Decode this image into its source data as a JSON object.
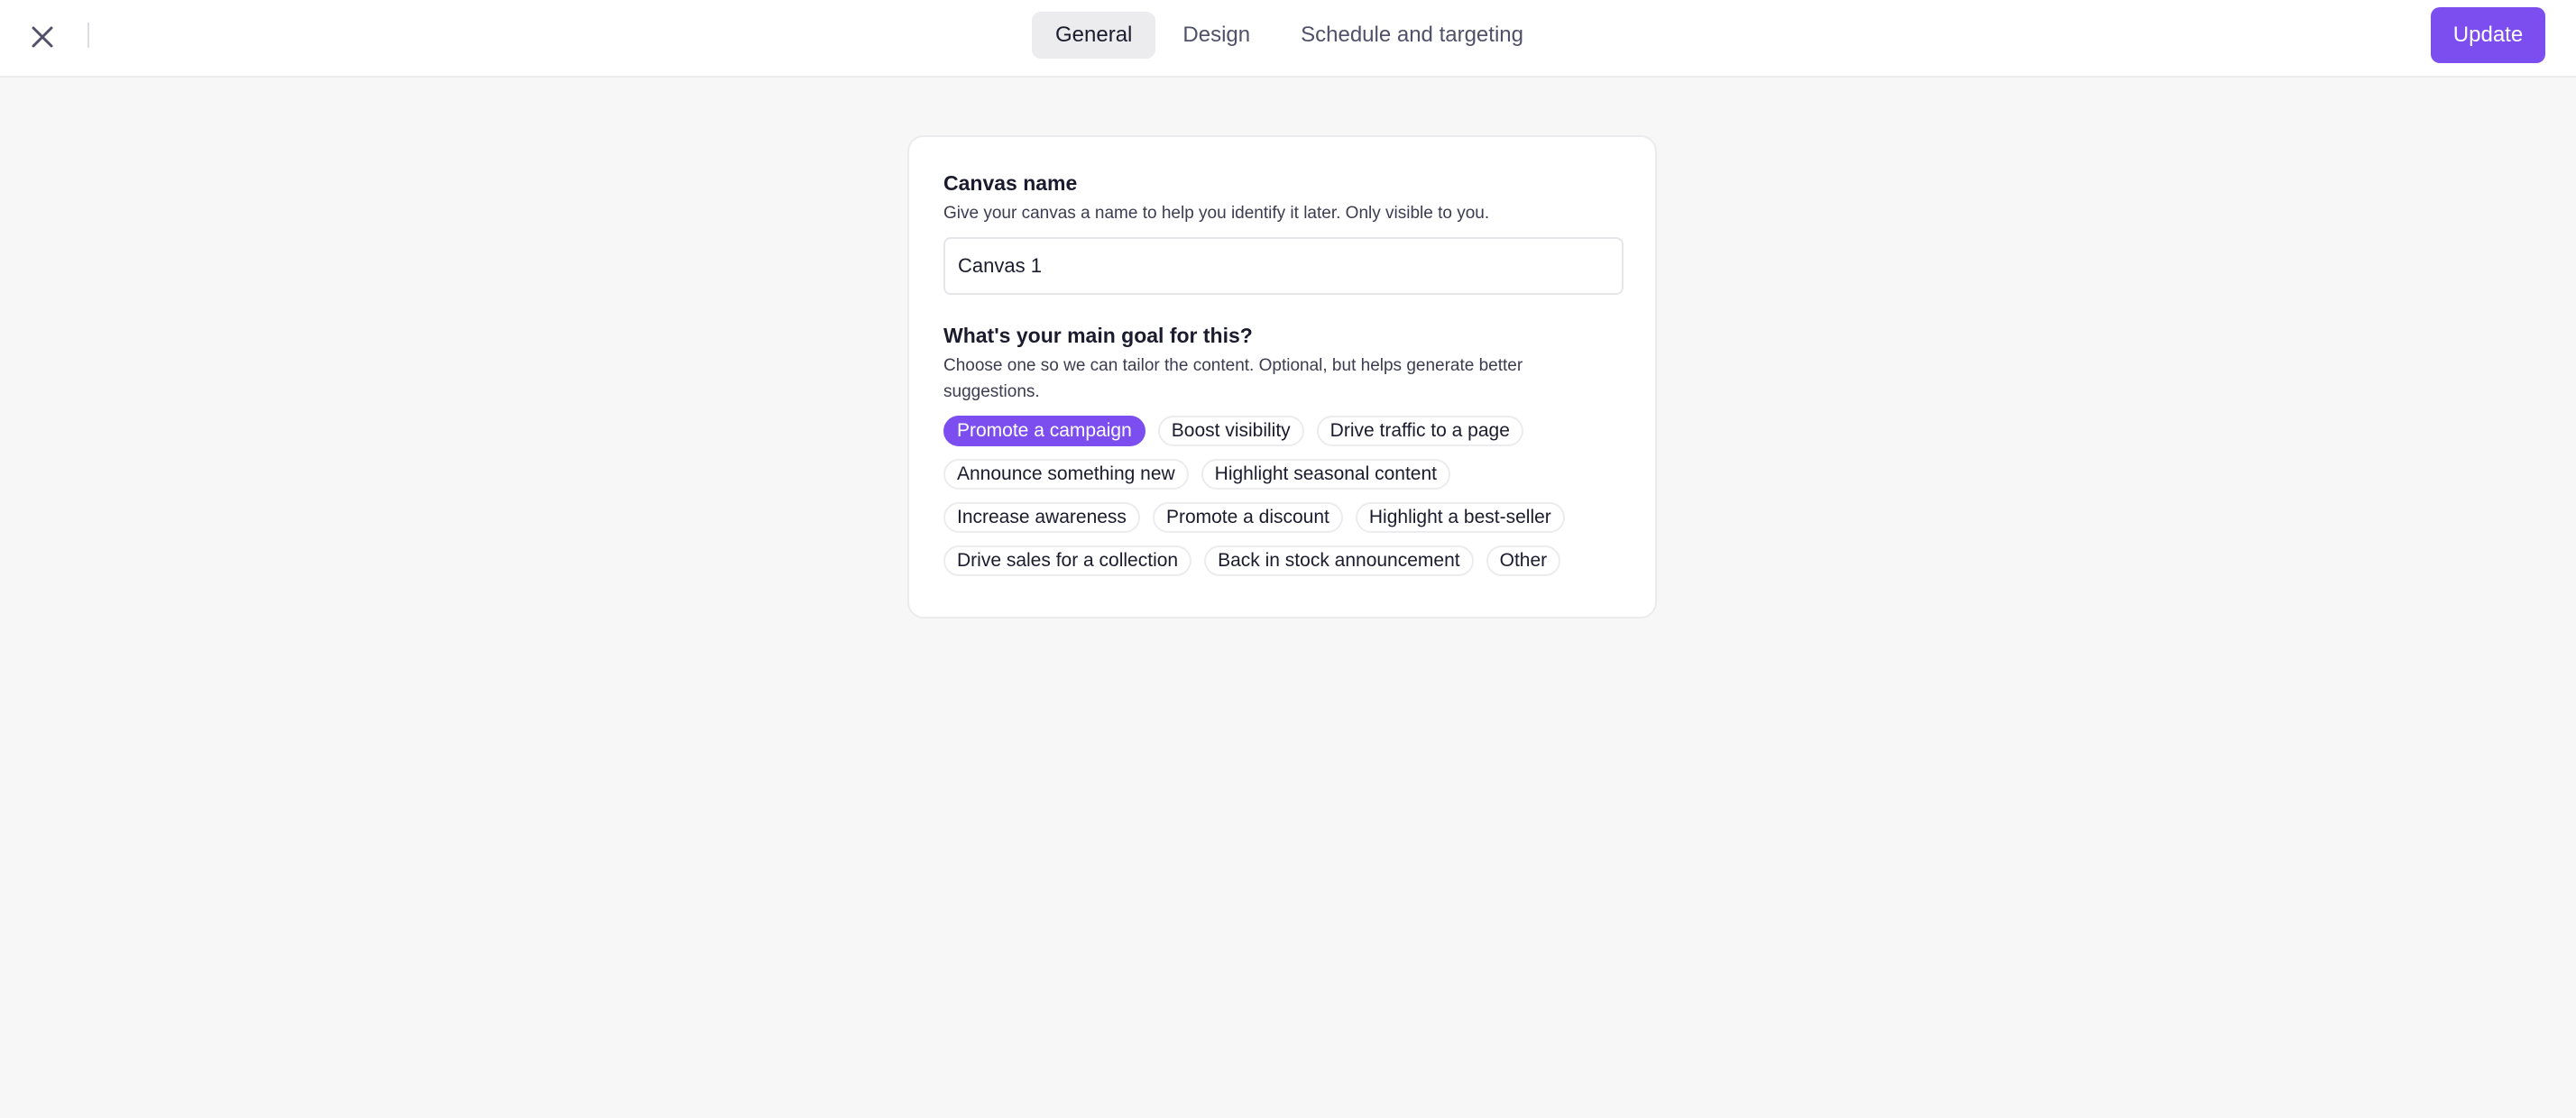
{
  "header": {
    "close_icon": "close-icon",
    "tabs": [
      {
        "label": "General",
        "active": true
      },
      {
        "label": "Design",
        "active": false
      },
      {
        "label": "Schedule and targeting",
        "active": false
      }
    ],
    "update_label": "Update"
  },
  "form": {
    "canvas_name": {
      "label": "Canvas name",
      "helper": "Give your canvas a name to help you identify it later. Only visible to you.",
      "value": "Canvas 1"
    },
    "goal": {
      "label": "What's your main goal for this?",
      "helper": "Choose one so we can tailor the content. Optional, but helps generate better suggestions.",
      "selected": "Promote a campaign",
      "options": [
        "Promote a campaign",
        "Boost visibility",
        "Drive traffic to a page",
        "Announce something new",
        "Highlight seasonal content",
        "Increase awareness",
        "Promote a discount",
        "Highlight a best-seller",
        "Drive sales for a collection",
        "Back in stock announcement",
        "Other"
      ]
    }
  },
  "colors": {
    "accent": "#7c4ef0",
    "background": "#f7f7f8",
    "card": "#ffffff"
  }
}
